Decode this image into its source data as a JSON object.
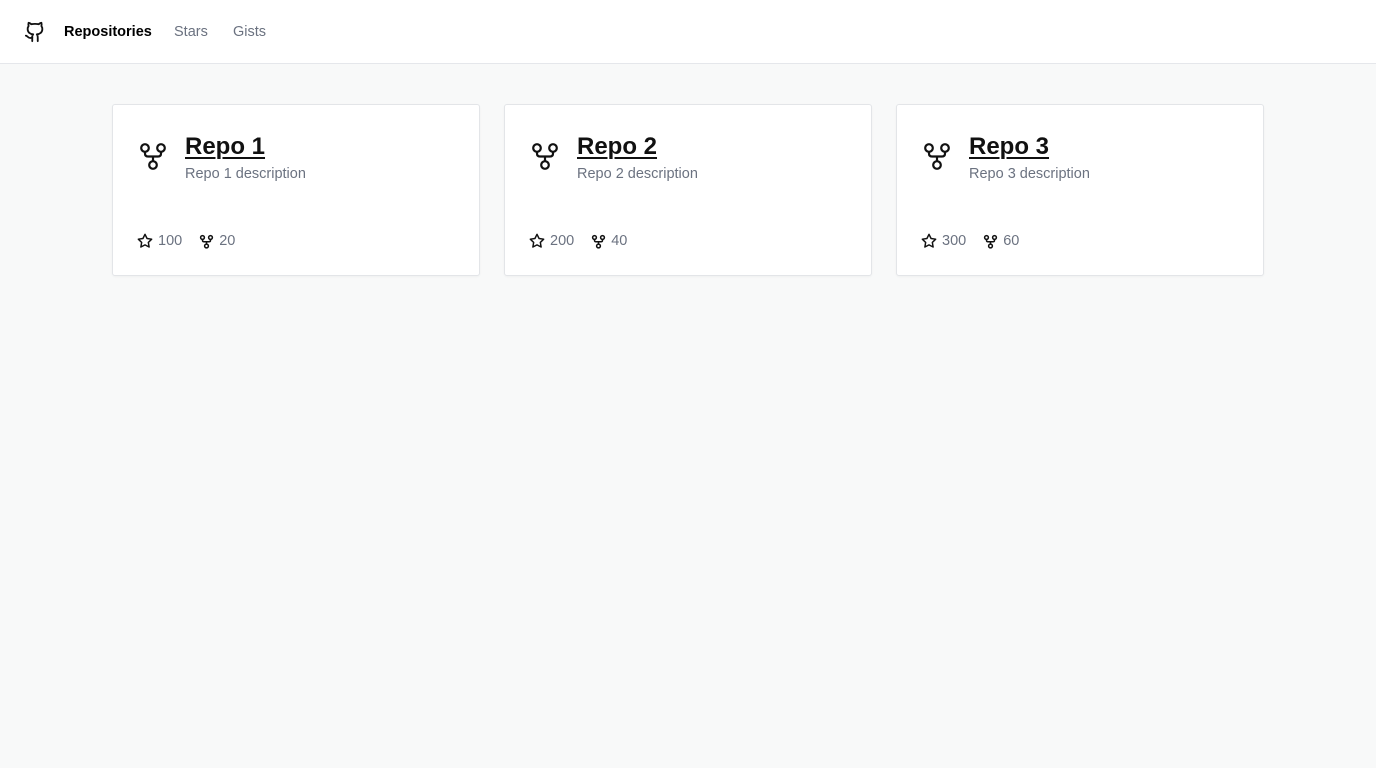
{
  "nav": {
    "logo_icon": "github-icon",
    "links": [
      {
        "label": "Repositories",
        "active": true
      },
      {
        "label": "Stars",
        "active": false
      },
      {
        "label": "Gists",
        "active": false
      }
    ]
  },
  "repos": [
    {
      "name": "Repo 1",
      "description": "Repo 1 description",
      "stars": "100",
      "forks": "20"
    },
    {
      "name": "Repo 2",
      "description": "Repo 2 description",
      "stars": "200",
      "forks": "40"
    },
    {
      "name": "Repo 3",
      "description": "Repo 3 description",
      "stars": "300",
      "forks": "60"
    }
  ],
  "icons": {
    "repo": "git-fork-icon",
    "stars": "star-icon",
    "forks": "git-fork-icon"
  },
  "colors": {
    "page_background": "#f8f9f9",
    "text_primary": "#111111",
    "text_muted": "#6b7280",
    "border": "#e3e5e8"
  }
}
